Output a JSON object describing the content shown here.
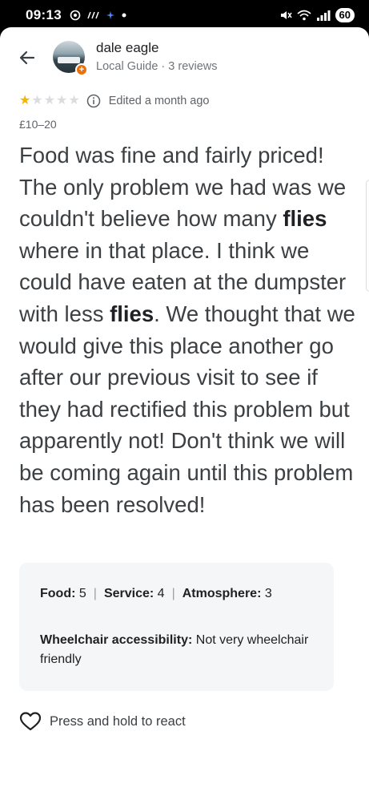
{
  "status_bar": {
    "time": "09:13",
    "battery": "60"
  },
  "header": {
    "user_name": "dale eagle",
    "user_meta": "Local Guide · 3 reviews",
    "badge_glyph": "+"
  },
  "rating": {
    "stars_filled": 1,
    "stars_total": 5,
    "edited_label": "Edited a month ago",
    "star_color": "#f4b400"
  },
  "price": "£10–20",
  "review": {
    "segments": [
      {
        "text": "Food was fine and fairly priced! The only problem we had was we couldn't believe how many ",
        "bold": false
      },
      {
        "text": "flies",
        "bold": true
      },
      {
        "text": " where in that place. I think we could have eaten at the dumpster with less ",
        "bold": false
      },
      {
        "text": "flies",
        "bold": true
      },
      {
        "text": ". We thought that we would give this place another go after our previous visit to see if they had rectified this problem but apparently not! Don't think we will be coming again until this problem has been resolved!",
        "bold": false
      }
    ]
  },
  "attributes": {
    "food_label": "Food:",
    "food_value": "5",
    "service_label": "Service:",
    "service_value": "4",
    "atmosphere_label": "Atmosphere:",
    "atmosphere_value": "3",
    "separator": "|",
    "wheelchair_label": "Wheelchair accessibility:",
    "wheelchair_value": "Not very wheelchair friendly"
  },
  "react": {
    "label": "Press and hold to react"
  }
}
